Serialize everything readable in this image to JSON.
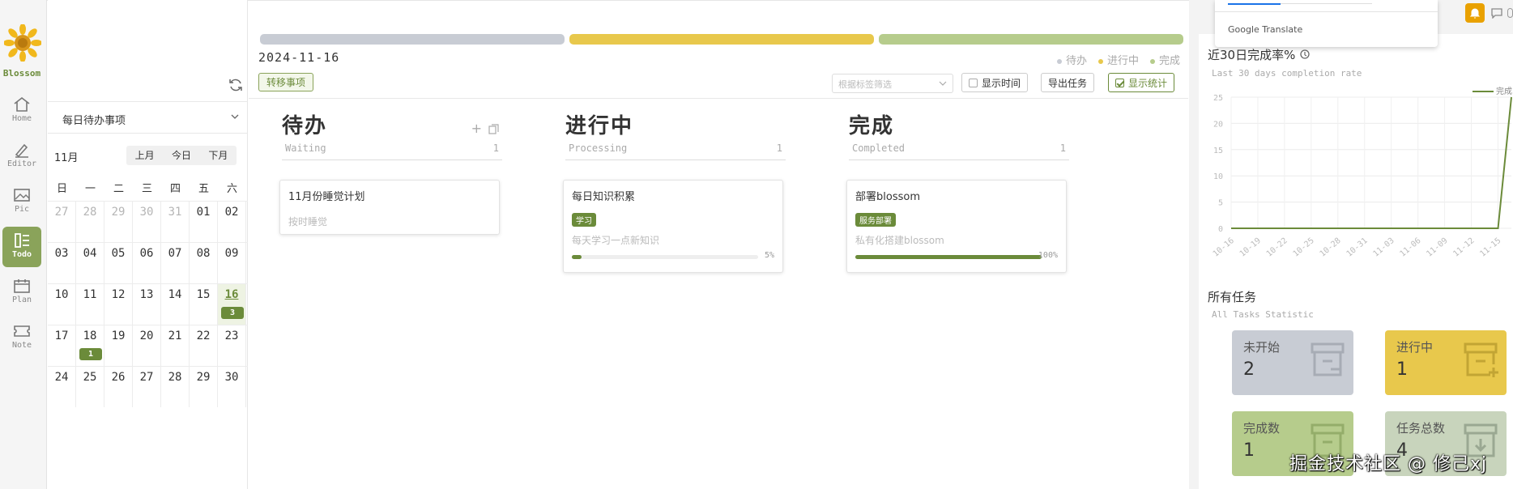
{
  "app": {
    "logo_text": "Blossom"
  },
  "nav": [
    {
      "label": "Home",
      "icon": "home-icon"
    },
    {
      "label": "Editor",
      "icon": "editor-icon"
    },
    {
      "label": "Pic",
      "icon": "picture-icon"
    },
    {
      "label": "Todo",
      "icon": "todo-icon",
      "active": true
    },
    {
      "label": "Plan",
      "icon": "calendar-icon"
    },
    {
      "label": "Note",
      "icon": "ticket-icon"
    }
  ],
  "calendar": {
    "select_value": "每日待办事项",
    "month_label": "11月",
    "buttons": [
      "上月",
      "今日",
      "下月"
    ],
    "weekdays": [
      "日",
      "一",
      "二",
      "三",
      "四",
      "五",
      "六"
    ],
    "weeks": [
      [
        {
          "d": "27",
          "m": true
        },
        {
          "d": "28",
          "m": true
        },
        {
          "d": "29",
          "m": true
        },
        {
          "d": "30",
          "m": true
        },
        {
          "d": "31",
          "m": true
        },
        {
          "d": "01"
        },
        {
          "d": "02"
        }
      ],
      [
        {
          "d": "03"
        },
        {
          "d": "04"
        },
        {
          "d": "05"
        },
        {
          "d": "06"
        },
        {
          "d": "07"
        },
        {
          "d": "08"
        },
        {
          "d": "09"
        }
      ],
      [
        {
          "d": "10"
        },
        {
          "d": "11"
        },
        {
          "d": "12"
        },
        {
          "d": "13"
        },
        {
          "d": "14"
        },
        {
          "d": "15"
        },
        {
          "d": "16",
          "today": true,
          "badge": "3"
        }
      ],
      [
        {
          "d": "17"
        },
        {
          "d": "18",
          "badge": "1"
        },
        {
          "d": "19"
        },
        {
          "d": "20"
        },
        {
          "d": "21"
        },
        {
          "d": "22"
        },
        {
          "d": "23"
        }
      ],
      [
        {
          "d": "24"
        },
        {
          "d": "25"
        },
        {
          "d": "26"
        },
        {
          "d": "27"
        },
        {
          "d": "28"
        },
        {
          "d": "29"
        },
        {
          "d": "30"
        }
      ]
    ]
  },
  "board": {
    "date": "2024-11-16",
    "status_colors": [
      "#c8ccd4",
      "#e8c84c",
      "#b6cc8c"
    ],
    "legend": [
      {
        "label": "待办",
        "color": "#c8ccd4"
      },
      {
        "label": "进行中",
        "color": "#e8c84c"
      },
      {
        "label": "完成",
        "color": "#b6cc8c"
      }
    ],
    "transfer_label": "转移事项",
    "tag_filter_placeholder": "根据标签筛选",
    "show_time_label": "显示时间",
    "export_label": "导出任务",
    "show_stats_label": "显示统计",
    "columns": [
      {
        "title": "待办",
        "subtitle": "Waiting",
        "count": "1"
      },
      {
        "title": "进行中",
        "subtitle": "Processing",
        "count": "1"
      },
      {
        "title": "完成",
        "subtitle": "Completed",
        "count": "1"
      }
    ],
    "cards": [
      {
        "title": "11月份睡觉计划",
        "desc": "按时睡觉"
      },
      {
        "title": "每日知识积累",
        "tag": "学习",
        "desc": "每天学习一点新知识",
        "progress": 5,
        "progress_label": "5%"
      },
      {
        "title": "部署blossom",
        "tag": "服务部署",
        "desc": "私有化搭建blossom",
        "progress": 100,
        "progress_label": "100%"
      }
    ]
  },
  "google_translate": {
    "label": "Google Translate"
  },
  "stats_chart": {
    "title": "近30日完成率%",
    "subtitle": "Last 30 days completion rate",
    "legend": "完成"
  },
  "chart_data": {
    "type": "line",
    "title": "近30日完成率%",
    "subtitle": "Last 30 days completion rate",
    "x": [
      "10-16",
      "10-19",
      "10-22",
      "10-25",
      "10-28",
      "10-31",
      "11-03",
      "11-06",
      "11-09",
      "11-12",
      "11-15"
    ],
    "y_ticks": [
      "0",
      "5",
      "10",
      "15",
      "20",
      "25"
    ],
    "ylim": [
      0,
      25
    ],
    "series": [
      {
        "name": "完成",
        "color": "#6b8b3a",
        "points": [
          [
            0,
            0
          ],
          [
            1,
            0
          ],
          [
            2,
            0
          ],
          [
            3,
            0
          ],
          [
            4,
            0
          ],
          [
            5,
            0
          ],
          [
            6,
            0
          ],
          [
            7,
            0
          ],
          [
            8,
            0
          ],
          [
            9,
            0
          ],
          [
            10,
            0
          ],
          [
            10.5,
            25
          ]
        ]
      }
    ]
  },
  "tasks": {
    "title": "所有任务",
    "subtitle": "All Tasks Statistic",
    "stats": [
      {
        "label": "未开始",
        "value": "2",
        "color": "#c8ccd4"
      },
      {
        "label": "进行中",
        "value": "1",
        "color": "#e8c84c"
      },
      {
        "label": "完成数",
        "value": "1",
        "color": "#b6cc8c"
      },
      {
        "label": "任务总数",
        "value": "4",
        "color": "#c8d4bc"
      }
    ]
  },
  "watermark": "掘金技术社区 @ 修己xj"
}
